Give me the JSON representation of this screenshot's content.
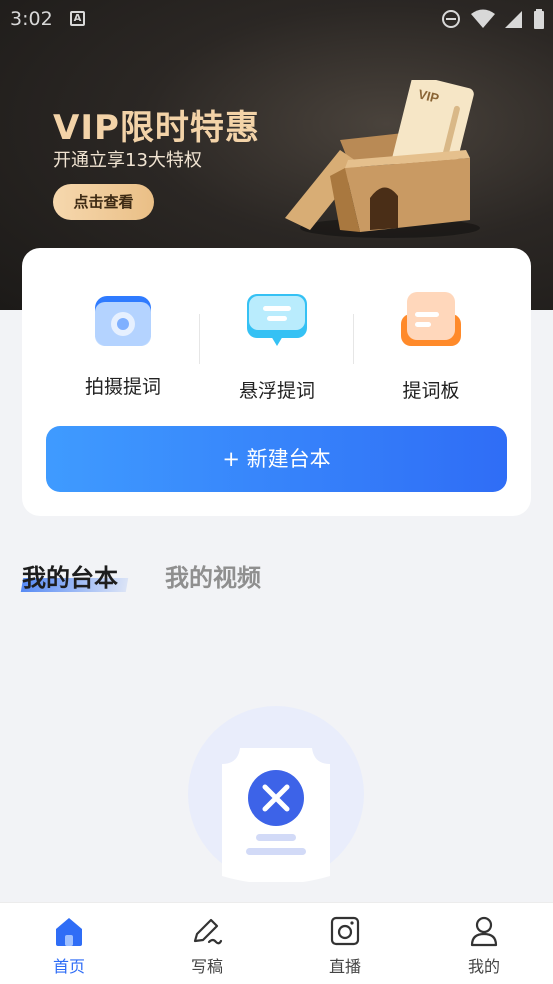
{
  "status_bar": {
    "time": "3:02",
    "a_glyph": "A"
  },
  "banner": {
    "title": "VIP限时特惠",
    "subtitle": "开通立享13大特权",
    "button_label": "点击查看",
    "card_text": "VIP"
  },
  "features": [
    {
      "label": "拍摄提词",
      "icon": "camera-icon"
    },
    {
      "label": "悬浮提词",
      "icon": "float-bubble-icon"
    },
    {
      "label": "提词板",
      "icon": "board-icon"
    }
  ],
  "new_script_button": "+ 新建台本",
  "tabs": [
    {
      "label": "我的台本",
      "active": true
    },
    {
      "label": "我的视频",
      "active": false
    }
  ],
  "bottom_nav": [
    {
      "label": "首页",
      "icon": "home-icon",
      "active": true
    },
    {
      "label": "写稿",
      "icon": "pen-icon",
      "active": false
    },
    {
      "label": "直播",
      "icon": "live-camera-icon",
      "active": false
    },
    {
      "label": "我的",
      "icon": "person-icon",
      "active": false
    }
  ],
  "colors": {
    "accent": "#2f6df6",
    "vip_gold": "#f3d3a8",
    "hero_bg": "#2b2724",
    "page_bg": "#f2f3f6"
  }
}
